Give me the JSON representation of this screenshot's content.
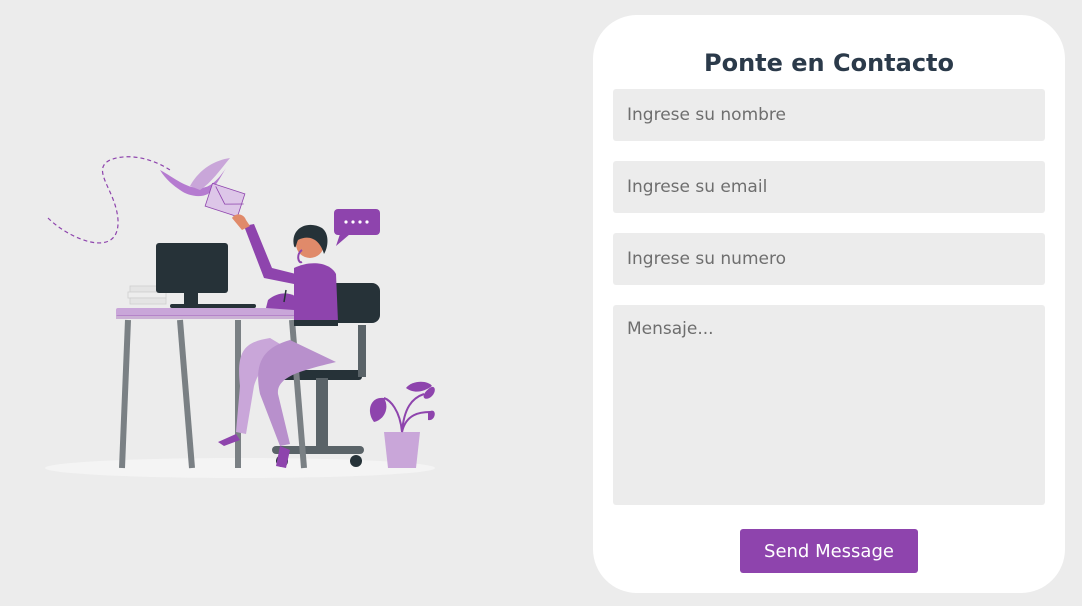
{
  "contact": {
    "title": "Ponte en Contacto",
    "name_placeholder": "Ingrese su nombre",
    "email_placeholder": "Ingrese su email",
    "number_placeholder": "Ingrese su numero",
    "message_placeholder": "Mensaje...",
    "send_label": "Send Message"
  },
  "illustration": {
    "subject": "woman-at-desk-on-phone",
    "speech_bubble_text": "....",
    "colors": {
      "accent": "#8e44ad",
      "light_accent": "#c9a6d9",
      "dark": "#263238"
    }
  },
  "colors": {
    "background": "#ececec",
    "card": "#ffffff",
    "title": "#2b3a4a",
    "field": "#ececec",
    "button": "#8e44ad",
    "button_text": "#ffffff"
  }
}
